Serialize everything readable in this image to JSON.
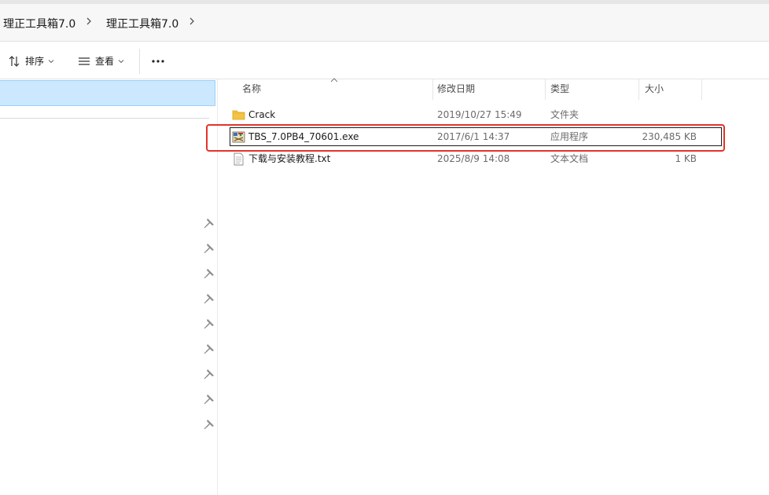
{
  "breadcrumbs": [
    "理正工具箱7.0",
    "理正工具箱7.0"
  ],
  "toolbar": {
    "sort_label": "排序",
    "view_label": "查看",
    "more_label": "···"
  },
  "columns": {
    "name": "名称",
    "modified": "修改日期",
    "type": "类型",
    "size": "大小"
  },
  "files": [
    {
      "name": "Crack",
      "modified": "2019/10/27 15:49",
      "type": "文件夹",
      "size": "",
      "icon": "folder-icon"
    },
    {
      "name": "TBS_7.0PB4_70601.exe",
      "modified": "2017/6/1 14:37",
      "type": "应用程序",
      "size": "230,485 KB",
      "icon": "installer-exe-icon"
    },
    {
      "name": "下载与安装教程.txt",
      "modified": "2025/8/9 14:08",
      "type": "文本文档",
      "size": "1 KB",
      "icon": "text-document-icon"
    }
  ],
  "highlight_color": "#e1342a",
  "selection_color": "#cce8ff",
  "folder_color": "#f5c343"
}
